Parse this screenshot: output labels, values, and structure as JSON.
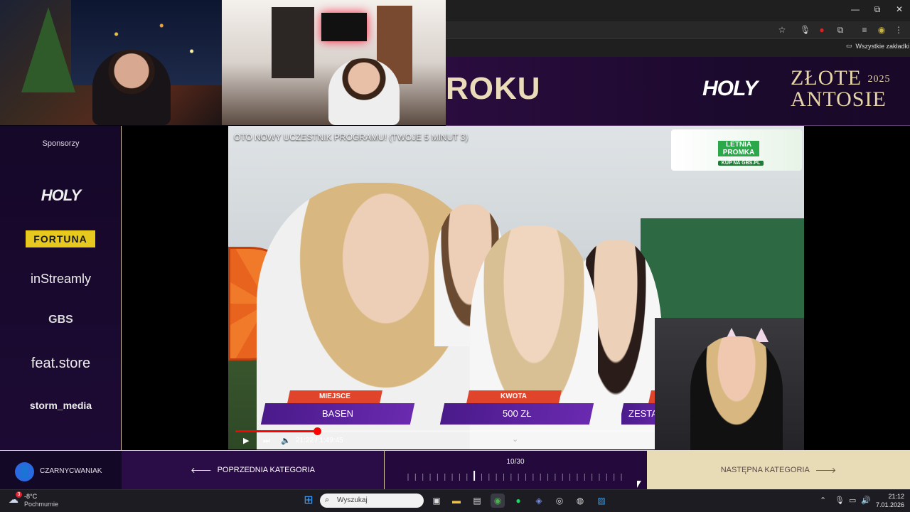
{
  "browser": {
    "window_controls": [
      "—",
      "⧉",
      "✕"
    ],
    "bookmarks_label": "Wszystkie zakładki"
  },
  "banner": {
    "title_fragment": "ROKU",
    "brand": "HOLY",
    "event_line1": "ZŁOTE",
    "event_line2": "ANTOSIE",
    "event_year": "2025"
  },
  "sidebar": {
    "title": "Sponsorzy",
    "sponsors": [
      "HOLY",
      "FORTUNA",
      "inStreamly",
      "GBS",
      "feat.store",
      "storm_media"
    ]
  },
  "video": {
    "title": "OTO NOWY UCZESTNIK PROGRAMU! (TWOJE 5 MINUT 3)",
    "ad": {
      "line1": "LETNIA",
      "line2": "PROMKA",
      "cta": "KUP NA GBS.PL"
    },
    "lower_thirds": [
      {
        "label": "MIEJSCE",
        "value": "BASEN"
      },
      {
        "label": "KWOTA",
        "value": "500 ZŁ"
      },
      {
        "label": "",
        "value": "ZESTA"
      }
    ],
    "time_display": "21:22 / 1:49:45",
    "progress": 0.195
  },
  "bottom_nav": {
    "username": "CZARNYCWANIAK",
    "prev_label": "POPRZEDNIA KATEGORIA",
    "counter": "10/30",
    "next_label": "NASTĘPNA KATEGORIA",
    "current_step": 10,
    "total_steps": 30
  },
  "taskbar": {
    "weather_temp": "-8°C",
    "weather_desc": "Pochmurnie",
    "search_placeholder": "Wyszukaj",
    "weather_badge": "3",
    "time": "21:12",
    "date": "7.01.2026"
  },
  "colors": {
    "accent_gold": "#e8dcb6",
    "panel_purple": "#2a0c46",
    "progress_red": "#ff0000"
  }
}
